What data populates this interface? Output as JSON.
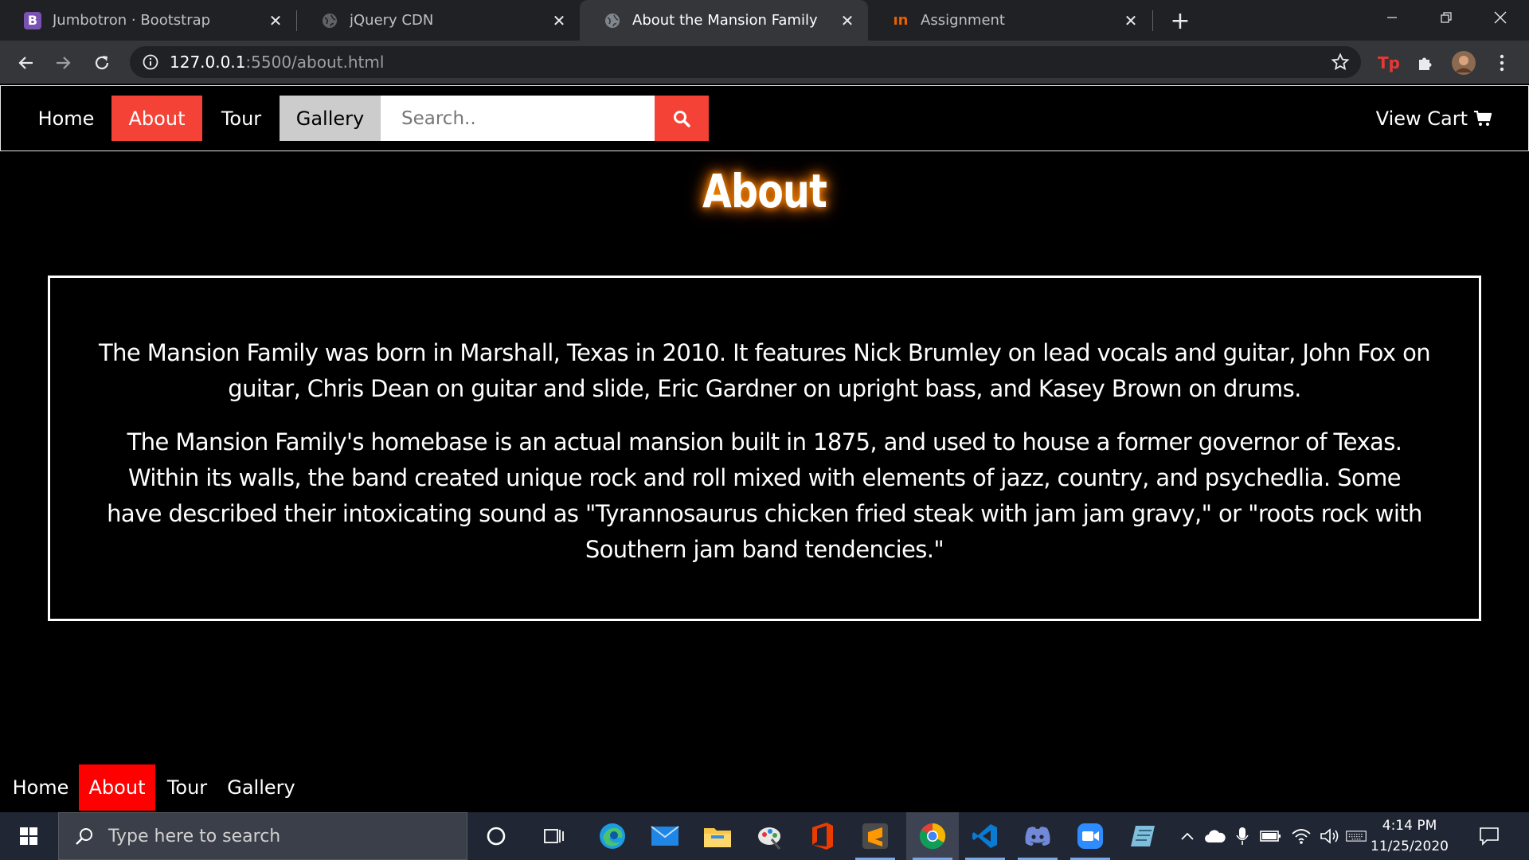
{
  "browser": {
    "tabs": [
      {
        "title": "Jumbotron · Bootstrap",
        "icon": "bootstrap-icon",
        "active": false
      },
      {
        "title": "jQuery CDN",
        "icon": "globe-icon",
        "active": false
      },
      {
        "title": "About the Mansion Family",
        "icon": "globe-icon",
        "active": true
      },
      {
        "title": "Assignment",
        "icon": "instructure-icon",
        "active": false
      }
    ],
    "url_host": "127.0.0.1",
    "url_rest": ":5500/about.html",
    "extension_badge": "Tp"
  },
  "site": {
    "nav": {
      "home": "Home",
      "about": "About",
      "tour": "Tour",
      "gallery": "Gallery",
      "search_placeholder": "Search..",
      "view_cart": "View Cart"
    },
    "page_title": "About",
    "paragraphs": [
      "The Mansion Family was born in Marshall, Texas in 2010. It features Nick Brumley on lead vocals and guitar, John Fox on guitar, Chris Dean on guitar and slide, Eric Gardner on upright bass, and Kasey Brown on drums.",
      "The Mansion Family's homebase is an actual mansion built in 1875, and used to house a former governor of Texas. Within its walls, the band created unique rock and roll mixed with elements of jazz, country, and psychedlia. Some have described their intoxicating sound as \"Tyrannosaurus chicken fried steak with jam jam gravy,\" or \"roots rock with Southern jam band tendencies.\""
    ],
    "footer_nav": {
      "home": "Home",
      "about": "About",
      "tour": "Tour",
      "gallery": "Gallery"
    },
    "colors": {
      "accent": "#f44336",
      "footer_active": "#ff0000",
      "title_glow": "#ff8c00"
    }
  },
  "taskbar": {
    "search_placeholder": "Type here to search",
    "time": "4:14 PM",
    "date": "11/25/2020"
  }
}
